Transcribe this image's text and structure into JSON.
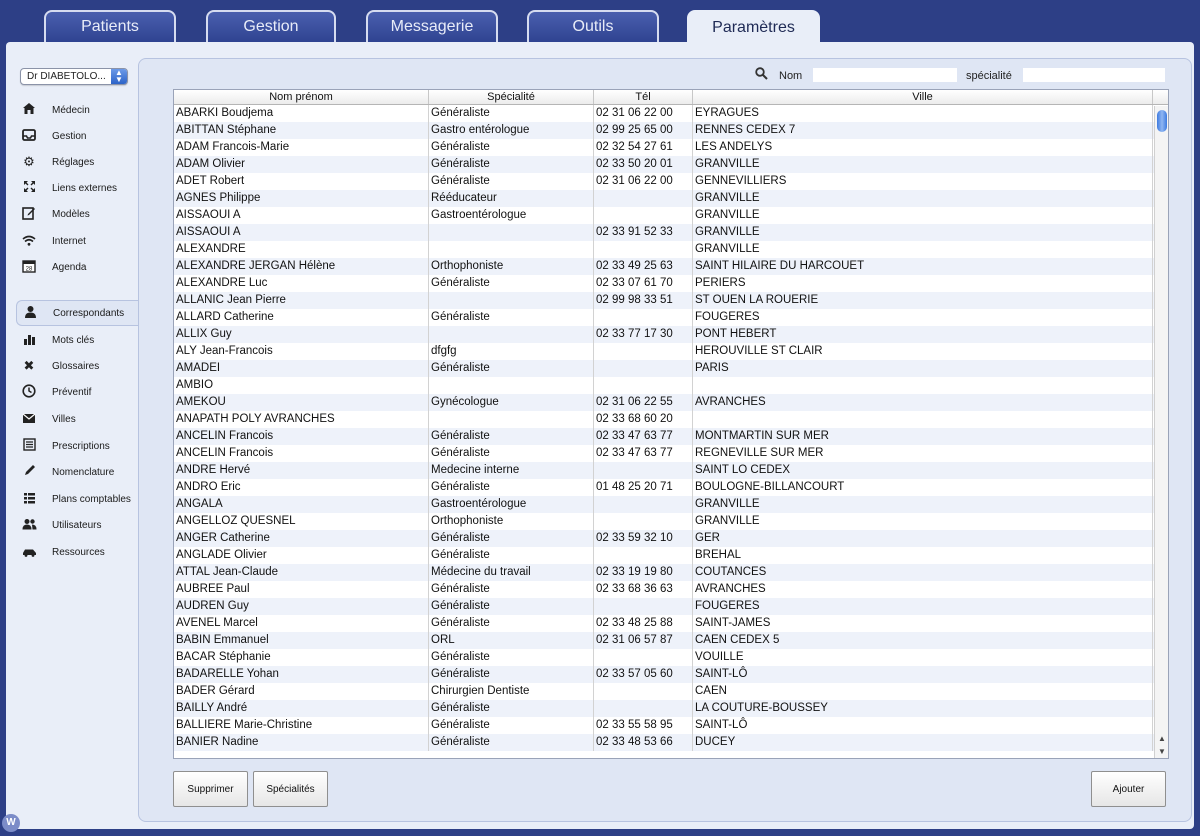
{
  "tabs": [
    {
      "label": "Patients"
    },
    {
      "label": "Gestion"
    },
    {
      "label": "Messagerie"
    },
    {
      "label": "Outils"
    },
    {
      "label": "Paramètres",
      "active": true
    }
  ],
  "sidebar": {
    "doctor_select": "Dr DIABETOLO...",
    "items": [
      {
        "label": "Médecin",
        "icon": "home-icon"
      },
      {
        "label": "Gestion",
        "icon": "inbox-icon"
      },
      {
        "label": "Réglages",
        "icon": "gear-icon"
      },
      {
        "label": "Liens externes",
        "icon": "expand-icon"
      },
      {
        "label": "Modèles",
        "icon": "edit-icon"
      },
      {
        "label": "Internet",
        "icon": "wifi-icon"
      },
      {
        "label": "Agenda",
        "icon": "calendar-icon"
      },
      {
        "label": "Correspondants",
        "icon": "person-icon",
        "active": true
      },
      {
        "label": "Mots clés",
        "icon": "bar-chart-icon"
      },
      {
        "label": "Glossaires",
        "icon": "tools-icon"
      },
      {
        "label": "Préventif",
        "icon": "clock-icon"
      },
      {
        "label": "Villes",
        "icon": "envelope-icon"
      },
      {
        "label": "Prescriptions",
        "icon": "list-icon"
      },
      {
        "label": "Nomenclature",
        "icon": "pencil-icon"
      },
      {
        "label": "Plans comptables",
        "icon": "list-bullets-icon"
      },
      {
        "label": "Utilisateurs",
        "icon": "users-icon"
      },
      {
        "label": "Ressources",
        "icon": "car-icon"
      }
    ]
  },
  "search": {
    "name_label": "Nom",
    "specialty_label": "spécialité",
    "name_value": "",
    "specialty_value": ""
  },
  "table": {
    "headers": [
      "Nom prénom",
      "Spécialité",
      "Tél",
      "Ville"
    ],
    "rows": [
      [
        "ABARKI Boudjema",
        "Généraliste",
        "02 31 06 22 00",
        "EYRAGUES"
      ],
      [
        "ABITTAN Stéphane",
        "Gastro entérologue",
        "02 99 25 65 00",
        "RENNES CEDEX 7"
      ],
      [
        "ADAM Francois-Marie",
        "Généraliste",
        "02 32 54 27 61",
        "LES ANDELYS"
      ],
      [
        "ADAM Olivier",
        "Généraliste",
        "02 33 50 20 01",
        "GRANVILLE"
      ],
      [
        "ADET Robert",
        "Généraliste",
        "02 31 06 22 00",
        "GENNEVILLIERS"
      ],
      [
        "AGNES Philippe",
        "Rééducateur",
        "",
        "GRANVILLE"
      ],
      [
        "AISSAOUI A",
        "Gastroentérologue",
        "",
        "GRANVILLE"
      ],
      [
        "AISSAOUI A",
        "",
        "02 33 91 52 33",
        "GRANVILLE"
      ],
      [
        "ALEXANDRE",
        "",
        "",
        "GRANVILLE"
      ],
      [
        "ALEXANDRE JERGAN Hélène",
        "Orthophoniste",
        "02 33 49 25 63",
        "SAINT HILAIRE DU HARCOUET"
      ],
      [
        "ALEXANDRE Luc",
        "Généraliste",
        "02 33 07 61 70",
        "PERIERS"
      ],
      [
        "ALLANIC Jean Pierre",
        "",
        "02 99 98 33 51",
        "ST OUEN LA ROUERIE"
      ],
      [
        "ALLARD Catherine",
        "Généraliste",
        "",
        "FOUGERES"
      ],
      [
        "ALLIX Guy",
        "",
        "02 33 77 17 30",
        "PONT HEBERT"
      ],
      [
        "ALY Jean-Francois",
        "dfgfg",
        "",
        "HEROUVILLE ST CLAIR"
      ],
      [
        "AMADEI",
        "Généraliste",
        "",
        "PARIS"
      ],
      [
        "AMBIO",
        "",
        "",
        ""
      ],
      [
        "AMEKOU",
        "Gynécologue",
        "02 31 06 22 55",
        "AVRANCHES"
      ],
      [
        "ANAPATH POLY AVRANCHES",
        "",
        "02 33 68 60 20",
        ""
      ],
      [
        "ANCELIN Francois",
        "Généraliste",
        "02 33 47 63 77",
        "MONTMARTIN SUR MER"
      ],
      [
        "ANCELIN Francois",
        "Généraliste",
        "02 33 47 63 77",
        "REGNEVILLE SUR MER"
      ],
      [
        "ANDRE Hervé",
        "Medecine interne",
        "",
        "SAINT LO CEDEX"
      ],
      [
        "ANDRO Eric",
        "Généraliste",
        "01 48 25 20 71",
        "BOULOGNE-BILLANCOURT"
      ],
      [
        "ANGALA",
        "Gastroentérologue",
        "",
        "GRANVILLE"
      ],
      [
        "ANGELLOZ QUESNEL",
        "Orthophoniste",
        "",
        "GRANVILLE"
      ],
      [
        "ANGER Catherine",
        "Généraliste",
        "02 33 59 32 10",
        "GER"
      ],
      [
        "ANGLADE Olivier",
        "Généraliste",
        "",
        "BREHAL"
      ],
      [
        "ATTAL Jean-Claude",
        "Médecine du travail",
        "02 33 19 19 80",
        "COUTANCES"
      ],
      [
        "AUBREE Paul",
        "Généraliste",
        "02 33 68 36 63",
        "AVRANCHES"
      ],
      [
        "AUDREN Guy",
        "Généraliste",
        "",
        "FOUGERES"
      ],
      [
        "AVENEL Marcel",
        "Généraliste",
        "02 33 48 25 88",
        "SAINT-JAMES"
      ],
      [
        "BABIN Emmanuel",
        "ORL",
        "02 31 06 57 87",
        "CAEN CEDEX 5"
      ],
      [
        "BACAR Stéphanie",
        "Généraliste",
        "",
        "VOUILLE"
      ],
      [
        "BADARELLE Yohan",
        "Généraliste",
        "02 33 57 05 60",
        "SAINT-LÔ"
      ],
      [
        "BADER Gérard",
        "Chirurgien Dentiste",
        "",
        "CAEN"
      ],
      [
        "BAILLY André",
        "Généraliste",
        "",
        "LA COUTURE-BOUSSEY"
      ],
      [
        "BALLIERE Marie-Christine",
        "Généraliste",
        "02 33 55 58 95",
        "SAINT-LÔ"
      ],
      [
        "BANIER Nadine",
        "Généraliste",
        "02 33 48 53 66",
        "DUCEY"
      ]
    ]
  },
  "buttons": {
    "delete": "Supprimer",
    "specialties": "Spécialités",
    "add": "Ajouter"
  },
  "corner_badge": "W"
}
